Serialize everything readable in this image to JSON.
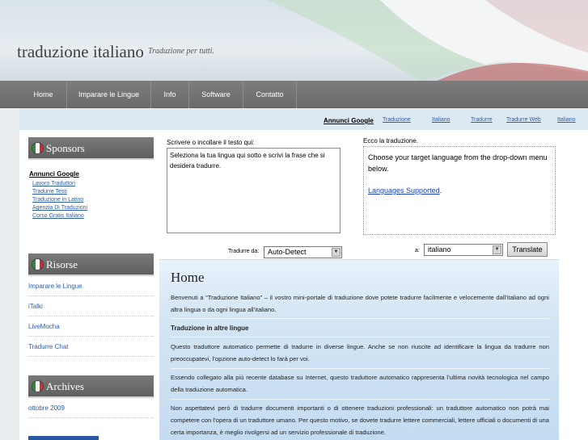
{
  "header": {
    "title": "traduzione italiano",
    "tagline": "Traduzione per tutti."
  },
  "nav": {
    "items": [
      {
        "label": "Home"
      },
      {
        "label": "Imparare le Lingue"
      },
      {
        "label": "Info"
      },
      {
        "label": "Software"
      },
      {
        "label": "Contatto"
      }
    ]
  },
  "ads_strip": {
    "label": "Annunci Google",
    "links": [
      "Traduzione",
      "Italiano",
      "Tradurre",
      "Tradurre Web",
      "Italiano"
    ]
  },
  "sidebar": {
    "sponsors": {
      "heading": "Sponsors",
      "ads_label": "Annunci Google",
      "links": [
        "Lavoro Traduttori",
        "Tradurre Testi",
        "Traduzione in Latino",
        "Agenzia Di Traduzioni",
        "Corso Gratis Italiano"
      ]
    },
    "risorse": {
      "heading": "Risorse",
      "links": [
        "Imparare le Lingue",
        "iTalki",
        "LiveMocha",
        "Tradurre Chat"
      ]
    },
    "archives": {
      "heading": "Archives",
      "links": [
        "ottobre 2009"
      ]
    }
  },
  "translator": {
    "input_label": "Scrivere o incollare il testo qui:",
    "input_value": "Seleziona la tua lingua qui sotto e scrivi la frase che si desidera tradurre.",
    "output_label": "Ecco la traduzione.",
    "output_text": "Choose your target language from the drop-down menu below.",
    "output_link": "Languages Supported",
    "output_link_suffix": ".",
    "from_label": "Tradurre da:",
    "from_value": "Auto-Detect",
    "to_label": "a:",
    "to_value": "italiano",
    "translate_button": "Translate"
  },
  "home": {
    "title": "Home",
    "intro": "Benvenuti a “Traduzione Italiano” – il vostro mini-portale di traduzione dove potete  tradurre facilmente e velocemente dall’italiano ad ogni altra lingua o da ogni lingua all’italiano.",
    "subheading": "Traduzione in altre lingue",
    "p1": "Questo traduttore automatico permette di tradurre in diverse lingue.  Anche se non riuscite ad identificare la lingua da tradurre non preoccupatevi, l’opzione auto-detect lo farà per voi.",
    "p2": "Essendo collegato alla più recente database su Internet, questo traduttore automatico rappresenta l’ultima novità tecnologica nel campo della traduzione automatica.",
    "p3": "Non aspettatevi però di tradurre documenti importanti o di ottenere traduzioni professionali: un traduttore automatico non potrà mai competere con l’opera di un traduttore umano.  Per questo motivo, se dovete tradurre lettere commerciali, lettere ufficiali o documenti di una certa importanza, è meglio rivolgersi ad un servizio professionale di traduzione."
  }
}
